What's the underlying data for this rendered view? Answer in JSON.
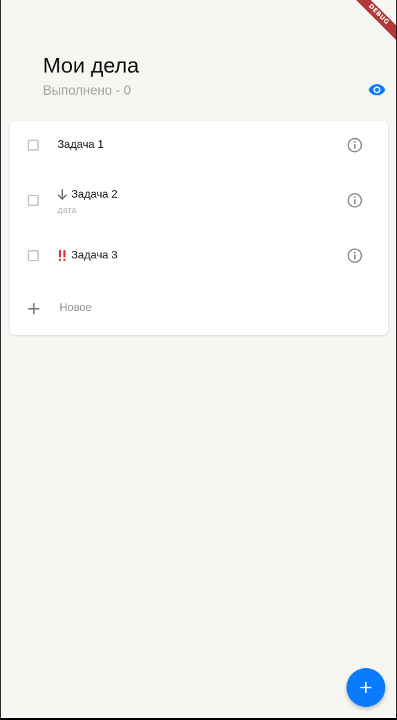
{
  "debug_banner": "DEBUG",
  "header": {
    "title": "Мои дела",
    "subtitle": "Выполнено - 0",
    "visibility_icon": "eye-icon"
  },
  "tasks": [
    {
      "label": "Задача 1",
      "date": "",
      "priority_icon": "",
      "done": false
    },
    {
      "label": "Задача 2",
      "date": "дата",
      "priority_icon": "arrow-down-icon",
      "done": false
    },
    {
      "label": "Задача 3",
      "date": "",
      "priority_icon": "double-exclamation-icon",
      "done": false
    }
  ],
  "new_item": {
    "label": "Новое",
    "icon": "plus-icon"
  },
  "fab": {
    "icon": "plus-icon"
  },
  "colors": {
    "background": "#f7f6f2",
    "accent": "#0a7bff",
    "priority_high": "#e53935",
    "secondary_text": "#a3a3a3"
  }
}
